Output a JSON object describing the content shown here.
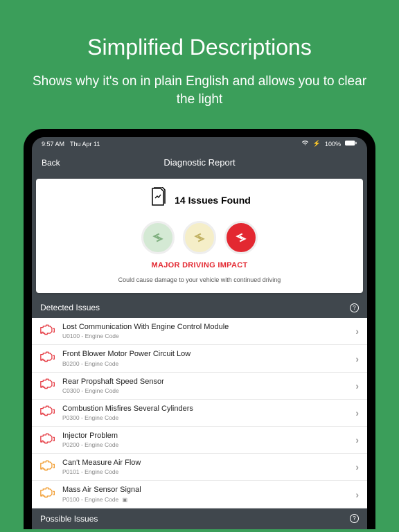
{
  "promo": {
    "title": "Simplified Descriptions",
    "subtitle": "Shows why it's on in plain English and allows you to clear the light"
  },
  "statusbar": {
    "time": "9:57 AM",
    "date": "Thu Apr 11",
    "battery": "100%"
  },
  "nav": {
    "back": "Back",
    "title": "Diagnostic Report"
  },
  "summary": {
    "title": "14 Issues Found",
    "impact_label": "MAJOR DRIVING IMPACT",
    "impact_desc": "Could cause damage to your vehicle with continued driving"
  },
  "sections": {
    "detected": "Detected Issues",
    "possible": "Possible Issues"
  },
  "issues": [
    {
      "title": "Lost Communication With Engine Control Module",
      "code": "U0100 - Engine Code",
      "severity": "red",
      "has_box": false
    },
    {
      "title": "Front Blower Motor Power Circuit Low",
      "code": "B0200 - Engine Code",
      "severity": "red",
      "has_box": false
    },
    {
      "title": "Rear Propshaft Speed Sensor",
      "code": "C0300 - Engine Code",
      "severity": "red",
      "has_box": false
    },
    {
      "title": "Combustion Misfires Several Cylinders",
      "code": "P0300 - Engine Code",
      "severity": "red",
      "has_box": false
    },
    {
      "title": "Injector Problem",
      "code": "P0200 - Engine Code",
      "severity": "red",
      "has_box": false
    },
    {
      "title": "Can't Measure Air Flow",
      "code": "P0101 - Engine Code",
      "severity": "orange",
      "has_box": false
    },
    {
      "title": "Mass Air Sensor Signal",
      "code": "P0100 - Engine Code",
      "severity": "orange",
      "has_box": true
    }
  ],
  "colors": {
    "bg": "#3b9e5a",
    "dark": "#40474d",
    "red": "#e32831",
    "orange": "#f0941e"
  }
}
